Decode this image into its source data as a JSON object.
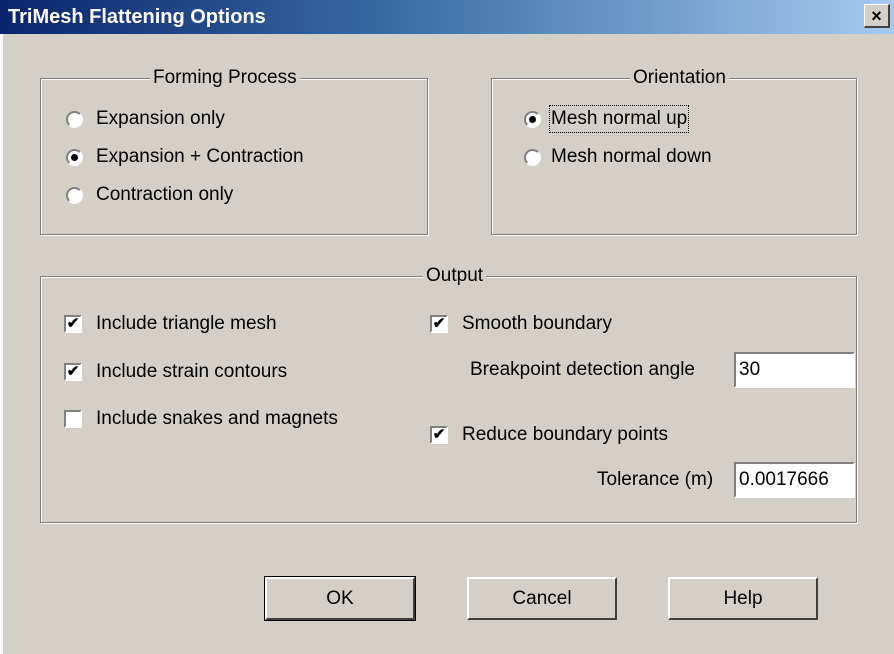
{
  "window": {
    "title": "TriMesh Flattening Options",
    "close_label": "×"
  },
  "forming": {
    "legend": "Forming Process",
    "options": [
      {
        "label": "Expansion only",
        "checked": false
      },
      {
        "label": "Expansion + Contraction",
        "checked": true
      },
      {
        "label": "Contraction only",
        "checked": false
      }
    ]
  },
  "orientation": {
    "legend": "Orientation",
    "options": [
      {
        "label": "Mesh normal up",
        "checked": true
      },
      {
        "label": "Mesh normal down",
        "checked": false
      }
    ]
  },
  "output": {
    "legend": "Output",
    "left_checks": [
      {
        "label": "Include triangle mesh",
        "checked": true
      },
      {
        "label": "Include strain contours",
        "checked": true
      },
      {
        "label": "Include snakes and magnets",
        "checked": false
      }
    ],
    "smooth_boundary": {
      "label": "Smooth boundary",
      "checked": true
    },
    "breakpoint": {
      "label": "Breakpoint detection angle",
      "value": "30"
    },
    "reduce_points": {
      "label": "Reduce boundary points",
      "checked": true
    },
    "tolerance": {
      "label": "Tolerance (m)",
      "value": "0.0017666"
    }
  },
  "buttons": {
    "ok": "OK",
    "cancel": "Cancel",
    "help": "Help"
  }
}
